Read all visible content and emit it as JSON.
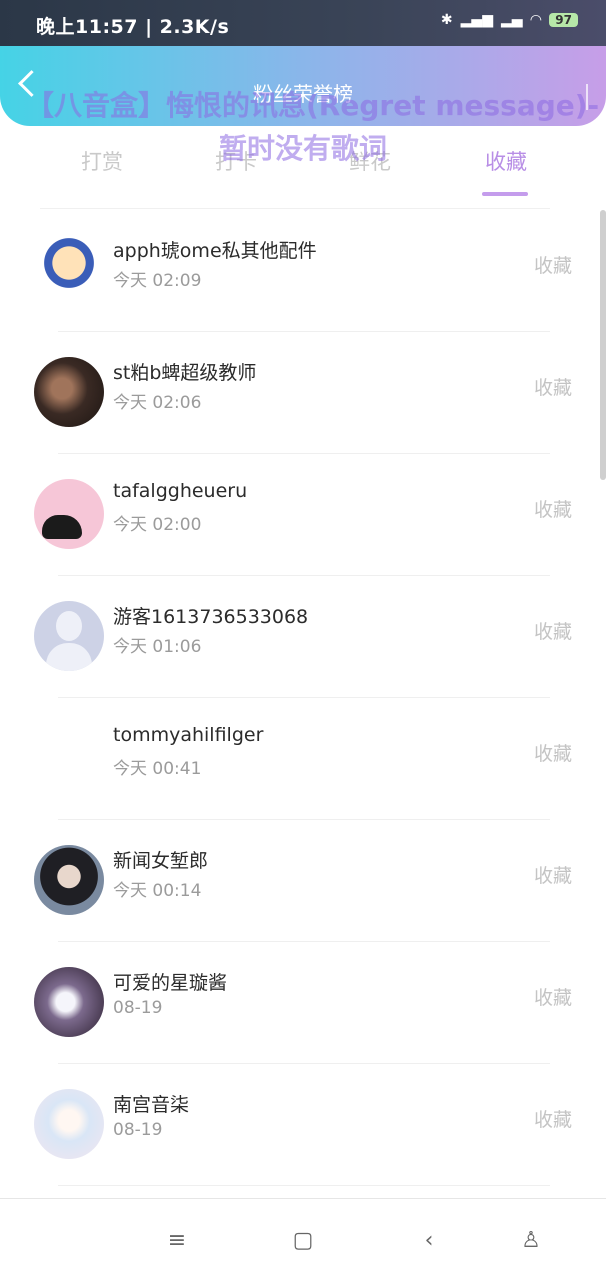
{
  "status_bar": {
    "time": "晚上11:57 | 2.3K/s",
    "battery": "97"
  },
  "header": {
    "title": "粉丝荣誉榜",
    "lyric_line1": "【八音盒】悔恨的讯息(Regret message)-",
    "lyric_line2": "暂时没有歌词"
  },
  "tabs": [
    {
      "label": "打赏",
      "active": false
    },
    {
      "label": "打卡",
      "active": false
    },
    {
      "label": "鲜花",
      "active": false
    },
    {
      "label": "收藏",
      "active": true
    }
  ],
  "list": {
    "items": [
      {
        "name": "apph琥ome私其他配件",
        "time": "今天 02:09",
        "action": "收藏"
      },
      {
        "name": "st粕b蜱超级教师",
        "time": "今天 02:06",
        "action": "收藏"
      },
      {
        "name": "tafalggheueru",
        "time": "今天 02:00",
        "action": "收藏"
      },
      {
        "name": "游客1613736533068",
        "time": "今天 01:06",
        "action": "收藏"
      },
      {
        "name": "tommyahilfilger",
        "time": "今天 00:41",
        "action": "收藏"
      },
      {
        "name": "新闻女堑郎",
        "time": "今天 00:14",
        "action": "收藏"
      },
      {
        "name": "可爱的星璇酱",
        "time": "08-19",
        "action": "收藏"
      },
      {
        "name": "南宫音柒",
        "time": "08-19",
        "action": "收藏"
      }
    ]
  },
  "colors": {
    "accent": "#b88ee6",
    "header_gradient_start": "#45d3e6",
    "header_gradient_end": "#c79ee8"
  },
  "icons": {
    "nav": [
      "menu-icon",
      "home-icon",
      "back-icon",
      "accessibility-icon"
    ]
  }
}
